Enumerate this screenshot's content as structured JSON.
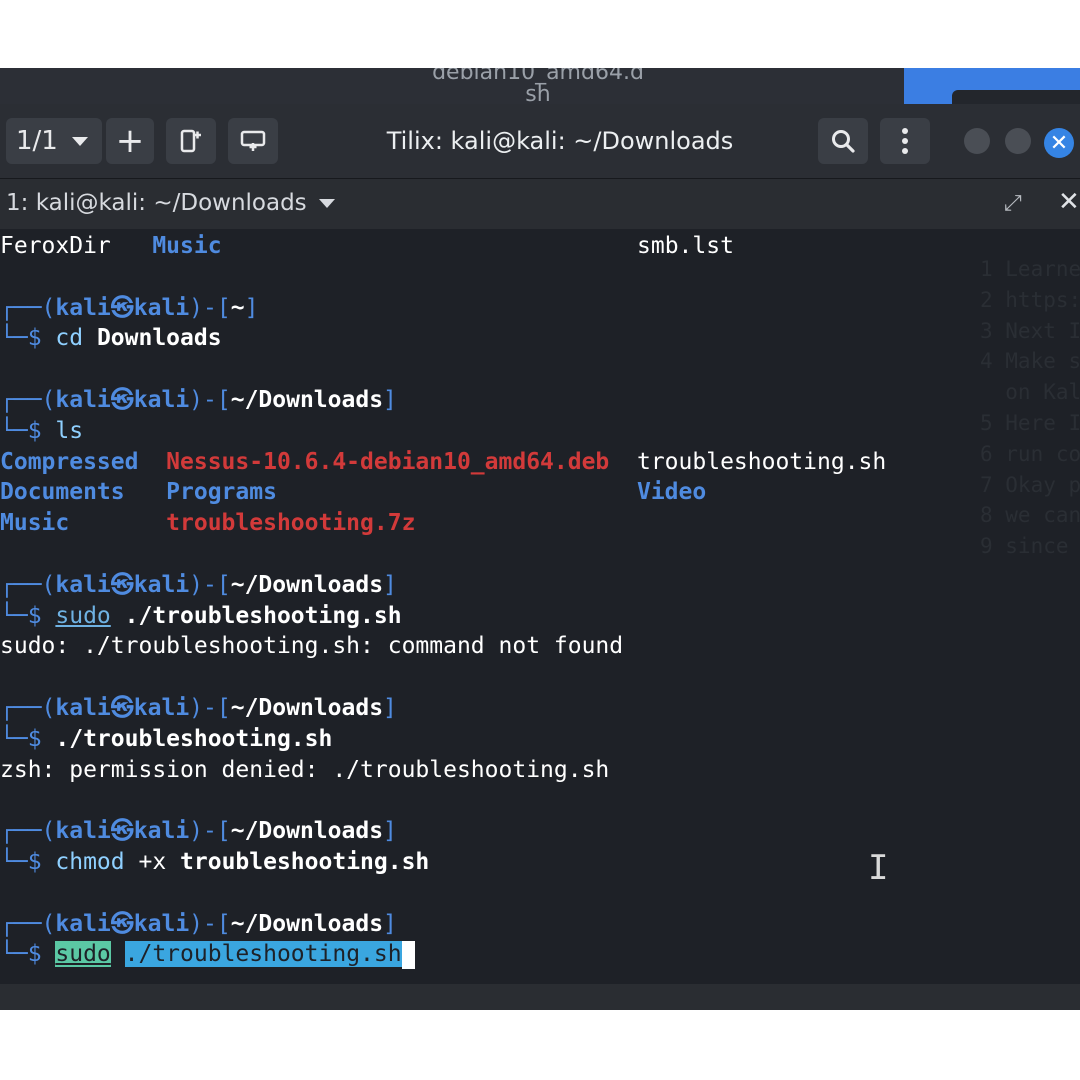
{
  "desktop": {
    "background_window_label": "debian10_amd64.d\nsh"
  },
  "window": {
    "title": "Tilix: kali@kali: ~/Downloads",
    "session_indicator": "1/1",
    "add_icon": "+",
    "close_icon": "✕"
  },
  "terminal": {
    "title": "1: kali@kali: ~/Downloads",
    "close_icon": "✕",
    "maximize_icon": "⤢",
    "lines": [
      {
        "segments": [
          {
            "text": "FeroxDir   ",
            "cls": "white"
          },
          {
            "text": "Music",
            "cls": "blue bold"
          },
          {
            "text": "                              ",
            "cls": ""
          },
          {
            "text": "smb.lst",
            "cls": "white"
          }
        ]
      },
      {
        "segments": []
      },
      {
        "segments": [
          {
            "text": "┌──(",
            "cls": "prompt-frame"
          },
          {
            "text": "kali㉿kali",
            "cls": "blue bold"
          },
          {
            "text": ")-[",
            "cls": "prompt-frame"
          },
          {
            "text": "~",
            "cls": "prompt-path"
          },
          {
            "text": "]",
            "cls": "prompt-frame"
          }
        ]
      },
      {
        "segments": [
          {
            "text": "└─$ ",
            "cls": "prompt-frame"
          },
          {
            "text": "cd ",
            "cls": "cmd"
          },
          {
            "text": "Downloads",
            "cls": "white bold"
          }
        ]
      },
      {
        "segments": []
      },
      {
        "segments": [
          {
            "text": "┌──(",
            "cls": "prompt-frame"
          },
          {
            "text": "kali㉿kali",
            "cls": "blue bold"
          },
          {
            "text": ")-[",
            "cls": "prompt-frame"
          },
          {
            "text": "~/Downloads",
            "cls": "prompt-path"
          },
          {
            "text": "]",
            "cls": "prompt-frame"
          }
        ]
      },
      {
        "segments": [
          {
            "text": "└─$ ",
            "cls": "prompt-frame"
          },
          {
            "text": "ls",
            "cls": "cmd"
          }
        ]
      },
      {
        "segments": [
          {
            "text": "Compressed  ",
            "cls": "blue bold"
          },
          {
            "text": "Nessus-10.6.4-debian10_amd64.deb",
            "cls": "red"
          },
          {
            "text": "  ",
            "cls": ""
          },
          {
            "text": "troubleshooting.sh",
            "cls": "white"
          }
        ]
      },
      {
        "segments": [
          {
            "text": "Documents   ",
            "cls": "blue bold"
          },
          {
            "text": "Programs",
            "cls": "blue bold"
          },
          {
            "text": "                          ",
            "cls": ""
          },
          {
            "text": "Video",
            "cls": "blue bold"
          }
        ]
      },
      {
        "segments": [
          {
            "text": "Music       ",
            "cls": "blue bold"
          },
          {
            "text": "troubleshooting.7z",
            "cls": "red"
          }
        ]
      },
      {
        "segments": []
      },
      {
        "segments": [
          {
            "text": "┌──(",
            "cls": "prompt-frame"
          },
          {
            "text": "kali㉿kali",
            "cls": "blue bold"
          },
          {
            "text": ")-[",
            "cls": "prompt-frame"
          },
          {
            "text": "~/Downloads",
            "cls": "prompt-path"
          },
          {
            "text": "]",
            "cls": "prompt-frame"
          }
        ]
      },
      {
        "segments": [
          {
            "text": "└─$ ",
            "cls": "prompt-frame"
          },
          {
            "text": "sudo",
            "cls": "ul"
          },
          {
            "text": " ./troubleshooting.sh",
            "cls": "white bold"
          }
        ]
      },
      {
        "segments": [
          {
            "text": "sudo: ./troubleshooting.sh: command not found",
            "cls": "white"
          }
        ]
      },
      {
        "segments": []
      },
      {
        "segments": [
          {
            "text": "┌──(",
            "cls": "prompt-frame"
          },
          {
            "text": "kali㉿kali",
            "cls": "blue bold"
          },
          {
            "text": ")-[",
            "cls": "prompt-frame"
          },
          {
            "text": "~/Downloads",
            "cls": "prompt-path"
          },
          {
            "text": "]",
            "cls": "prompt-frame"
          }
        ]
      },
      {
        "segments": [
          {
            "text": "└─$ ",
            "cls": "prompt-frame"
          },
          {
            "text": "./troubleshooting.sh",
            "cls": "white bold"
          }
        ]
      },
      {
        "segments": [
          {
            "text": "zsh: permission denied: ./troubleshooting.sh",
            "cls": "white"
          }
        ]
      },
      {
        "segments": []
      },
      {
        "segments": [
          {
            "text": "┌──(",
            "cls": "prompt-frame"
          },
          {
            "text": "kali㉿kali",
            "cls": "blue bold"
          },
          {
            "text": ")-[",
            "cls": "prompt-frame"
          },
          {
            "text": "~/Downloads",
            "cls": "prompt-path"
          },
          {
            "text": "]",
            "cls": "prompt-frame"
          }
        ]
      },
      {
        "segments": [
          {
            "text": "└─$ ",
            "cls": "prompt-frame"
          },
          {
            "text": "chmod",
            "cls": "cmd"
          },
          {
            "text": " +x ",
            "cls": "white"
          },
          {
            "text": "troubleshooting.sh",
            "cls": "white bold"
          }
        ]
      },
      {
        "segments": []
      },
      {
        "segments": [
          {
            "text": "┌──(",
            "cls": "prompt-frame"
          },
          {
            "text": "kali㉿kali",
            "cls": "blue bold"
          },
          {
            "text": ")-[",
            "cls": "prompt-frame"
          },
          {
            "text": "~/Downloads",
            "cls": "prompt-path"
          },
          {
            "text": "]",
            "cls": "prompt-frame"
          }
        ]
      },
      {
        "segments": [
          {
            "text": "└─$ ",
            "cls": "prompt-frame"
          },
          {
            "text": "sudo",
            "cls": "sel-green"
          },
          {
            "text": " ",
            "cls": ""
          },
          {
            "text": "./troubleshooting.sh",
            "cls": "sel-blue"
          },
          {
            "text": "",
            "cls": "cursor"
          }
        ]
      }
    ],
    "ghost_notes": [
      "1 Learne",
      "2 https:",
      "3 Next I",
      "4 Make s",
      "  on Kal",
      "5 Here I",
      "6 run co",
      "7 Okay p",
      "8 we can",
      "9 since"
    ]
  },
  "icons": {
    "search": "search-icon",
    "menu": "kebab-menu-icon",
    "cursor": "text-ibeam-icon"
  },
  "colors": {
    "accent": "#3584e4",
    "prompt_blue": "#4f8be0",
    "error_red": "#d23a3a",
    "selection_green": "#5bc8a4",
    "selection_blue": "#3aa6e0"
  }
}
